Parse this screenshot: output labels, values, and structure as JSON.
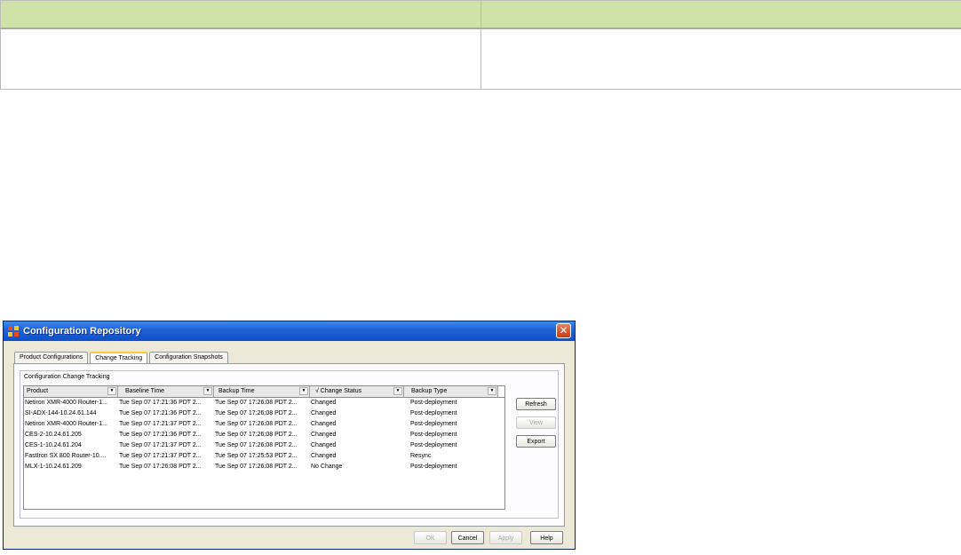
{
  "document_table": {
    "header": [
      "",
      ""
    ],
    "row": [
      "",
      ""
    ]
  },
  "dialog": {
    "title": "Configuration Repository",
    "close_glyph": "✕",
    "tabs": [
      "Product Configurations",
      "Change Tracking",
      "Configuration Snapshots"
    ],
    "active_tab": "Change Tracking",
    "group_title": "Configuration Change Tracking",
    "columns": [
      "Product",
      "Baseline Time",
      "Backup Time",
      "Change Status",
      "Backup Type"
    ],
    "change_status_prefix": "√",
    "rows": [
      [
        "Netiron XMR-4000 Router-1...",
        "Tue Sep 07 17:21:36 PDT 2...",
        "Tue Sep 07 17:26:08 PDT 2...",
        "Changed",
        "Post-deployment"
      ],
      [
        "SI-ADX-144-10.24.61.144",
        "Tue Sep 07 17:21:36 PDT 2...",
        "Tue Sep 07 17:26:08 PDT 2...",
        "Changed",
        "Post-deployment"
      ],
      [
        "Netiron XMR-4000 Router-1...",
        "Tue Sep 07 17:21:37 PDT 2...",
        "Tue Sep 07 17:26:08 PDT 2...",
        "Changed",
        "Post-deployment"
      ],
      [
        "CES-2-10.24.61.205",
        "Tue Sep 07 17:21:36 PDT 2...",
        "Tue Sep 07 17:26:08 PDT 2...",
        "Changed",
        "Post-deployment"
      ],
      [
        "CES-1-10.24.61.204",
        "Tue Sep 07 17:21:37 PDT 2...",
        "Tue Sep 07 17:26:08 PDT 2...",
        "Changed",
        "Post-deployment"
      ],
      [
        "FastIron SX 800 Router-10....",
        "Tue Sep 07 17:21:37 PDT 2...",
        "Tue Sep 07 17:25:53 PDT 2...",
        "Changed",
        "Resync"
      ],
      [
        "MLX-1-10.24.61.209",
        "Tue Sep 07 17:26:08 PDT 2...",
        "Tue Sep 07 17:26:08 PDT 2...",
        "No Change",
        "Post-deployment"
      ]
    ],
    "side_buttons": {
      "refresh": "Refresh",
      "view": "View",
      "export": "Export"
    },
    "bottom_buttons": {
      "ok": "OK",
      "cancel": "Cancel",
      "apply": "Apply",
      "help": "Help"
    },
    "title_bar_color": "#2163d6"
  }
}
